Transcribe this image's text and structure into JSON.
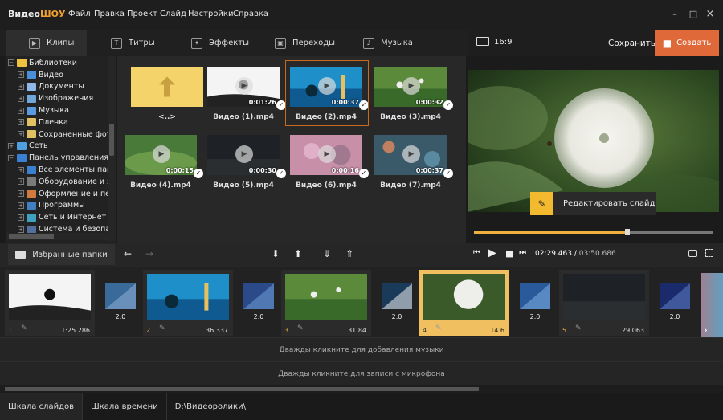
{
  "app": {
    "logo_a": "Видео",
    "logo_b": "ШОУ"
  },
  "menu": [
    "Файл",
    "Правка",
    "Проект",
    "Слайд",
    "Настройки",
    "Справка"
  ],
  "window_controls": [
    "–",
    "□",
    "×"
  ],
  "tabs": [
    {
      "label": "Клипы",
      "icon": "film-icon",
      "active": true
    },
    {
      "label": "Титры",
      "icon": "text-icon"
    },
    {
      "label": "Эффекты",
      "icon": "magic-icon"
    },
    {
      "label": "Переходы",
      "icon": "transition-icon"
    },
    {
      "label": "Музыка",
      "icon": "music-icon"
    }
  ],
  "preview_bar": {
    "aspect": "16:9",
    "save": "Сохранить",
    "create": "Создать"
  },
  "tree": [
    {
      "label": "Библиотеки",
      "level": 0,
      "exp": "−",
      "color": "#f0c040"
    },
    {
      "label": "Видео",
      "level": 1,
      "exp": "+",
      "color": "#4a8fd8"
    },
    {
      "label": "Документы",
      "level": 1,
      "exp": "+",
      "color": "#8fb8e8"
    },
    {
      "label": "Изображения",
      "level": 1,
      "exp": "+",
      "color": "#6fa8d8"
    },
    {
      "label": "Музыка",
      "level": 1,
      "exp": "+",
      "color": "#5a9ae0"
    },
    {
      "label": "Пленка",
      "level": 1,
      "exp": "+",
      "color": "#e0c060"
    },
    {
      "label": "Сохраненные фото",
      "level": 1,
      "exp": "+",
      "color": "#e0c060"
    },
    {
      "label": "Сеть",
      "level": 0,
      "exp": "+",
      "color": "#4fa0e0"
    },
    {
      "label": "Панель управления",
      "level": 0,
      "exp": "−",
      "color": "#3a80d0"
    },
    {
      "label": "Все элементы пан",
      "level": 1,
      "exp": "+",
      "color": "#3a80d0"
    },
    {
      "label": "Оборудование и зв",
      "level": 1,
      "exp": "+",
      "color": "#7a7a7a"
    },
    {
      "label": "Оформление и пер",
      "level": 1,
      "exp": "+",
      "color": "#d07a40"
    },
    {
      "label": "Программы",
      "level": 1,
      "exp": "+",
      "color": "#4080c0"
    },
    {
      "label": "Сеть и Интернет",
      "level": 1,
      "exp": "+",
      "color": "#40a0c0"
    },
    {
      "label": "Система и безопас",
      "level": 1,
      "exp": "+",
      "color": "#5070a0"
    }
  ],
  "files": [
    {
      "caption": "<..>",
      "duration": "",
      "kind": "folder"
    },
    {
      "caption": "Видео (1).mp4",
      "duration": "0:01:26",
      "kind": "bird"
    },
    {
      "caption": "Видео (2).mp4",
      "duration": "0:00:37",
      "kind": "water",
      "selected": true
    },
    {
      "caption": "Видео (3).mp4",
      "duration": "0:00:32",
      "kind": "grass"
    },
    {
      "caption": "Видео (4).mp4",
      "duration": "0:00:15",
      "kind": "green"
    },
    {
      "caption": "Видео (5).mp4",
      "duration": "0:00:30",
      "kind": "dark"
    },
    {
      "caption": "Видео (6).mp4",
      "duration": "0:00:16",
      "kind": "pink"
    },
    {
      "caption": "Видео (7).mp4",
      "duration": "0:00:37",
      "kind": "bokeh"
    }
  ],
  "edit_slide": "Редактировать слайд",
  "seek_position": 0.64,
  "favorites": "Избранные папки",
  "timecode": {
    "current": "02:29.463",
    "total": "03:50.686"
  },
  "slides": [
    {
      "num": "1",
      "length": "1:25.286",
      "kind": "bird"
    },
    {
      "num": "2",
      "length": "36.337",
      "kind": "water"
    },
    {
      "num": "3",
      "length": "31.84",
      "kind": "grass"
    },
    {
      "num": "4",
      "length": "14.6",
      "kind": "dandelion",
      "selected": true
    },
    {
      "num": "5",
      "length": "29.063",
      "kind": "dark"
    }
  ],
  "transitions": [
    "2.0",
    "2.0",
    "2.0",
    "2.0",
    "2.0"
  ],
  "music_hint": "Дважды кликните для добавления музыки",
  "mic_hint": "Дважды кликните для записи с микрофона",
  "status": {
    "slides_tab": "Шкала слайдов",
    "time_tab": "Шкала времени",
    "path": "D:\\Видеоролики\\"
  }
}
